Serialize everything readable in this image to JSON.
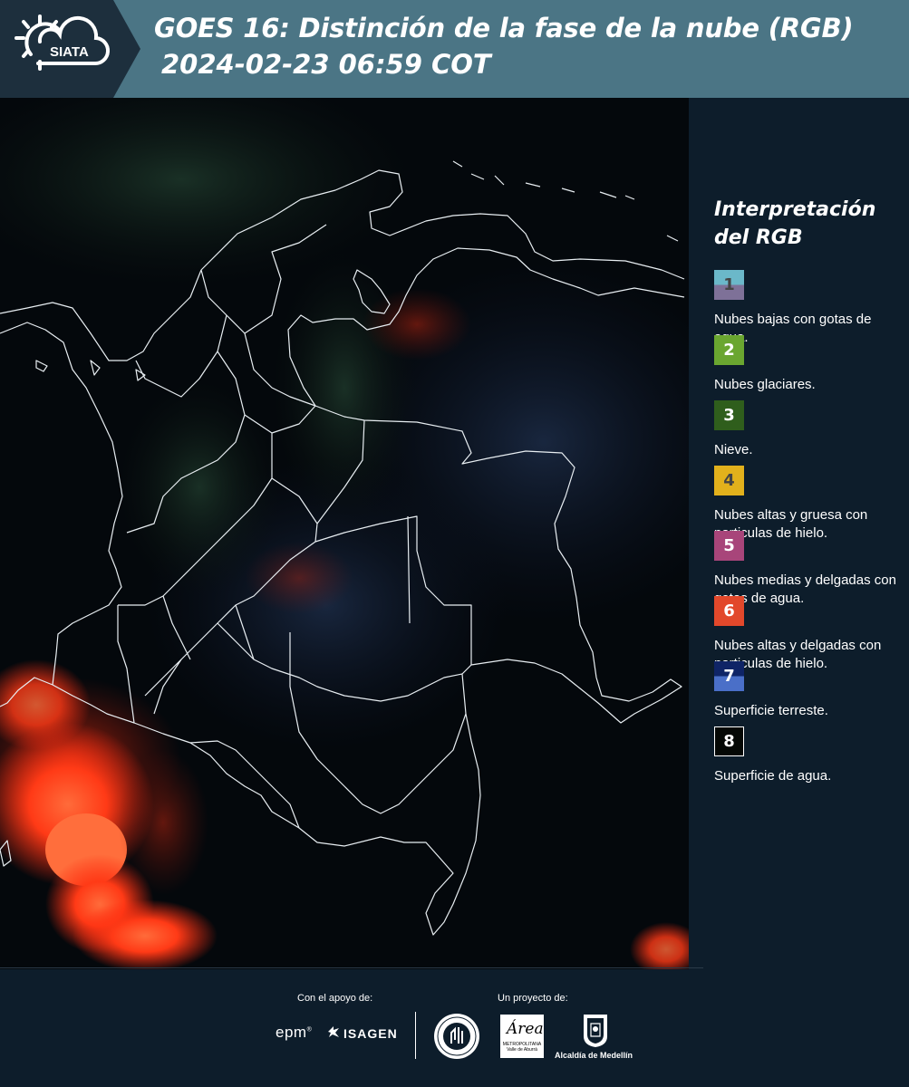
{
  "header": {
    "logo_text": "SIATA",
    "title_line1": "GOES 16: Distinción de la fase de la nube (RGB)",
    "title_line2": "2024-02-23 06:59 COT"
  },
  "legend": {
    "title_line1": "Interpretación",
    "title_line2": "del RGB",
    "items": [
      {
        "number": "1",
        "label": "Nubes bajas con gotas de agua.",
        "color_top": "#6bb8c9",
        "color_bottom": "#7e7198",
        "text_color": "#444444"
      },
      {
        "number": "2",
        "label": "Nubes glaciares.",
        "color": "#6aa630",
        "text_color": "#ffffff"
      },
      {
        "number": "3",
        "label": "Nieve.",
        "color": "#2f5e1c",
        "text_color": "#ffffff"
      },
      {
        "number": "4",
        "label": "Nubes altas y gruesa con particulas de hielo.",
        "color": "#e2b11c",
        "text_color": "#444444"
      },
      {
        "number": "5",
        "label": "Nubes medias y delgadas con gotas de agua.",
        "color": "#a8457a",
        "text_color": "#ffffff"
      },
      {
        "number": "6",
        "label": "Nubes altas y delgadas con particulas de hielo.",
        "color": "#e2482b",
        "text_color": "#ffffff"
      },
      {
        "number": "7",
        "label": "Superficie terreste.",
        "color_top": "#0f2466",
        "color_bottom": "#4a6fc8",
        "text_color": "#ffffff"
      },
      {
        "number": "8",
        "label": "Superficie de agua.",
        "color": "#050805",
        "text_color": "#ffffff",
        "border": "#ffffff"
      }
    ]
  },
  "footer": {
    "support_label": "Con el apoyo de:",
    "project_label": "Un proyecto de:",
    "epm": "epm",
    "isagen": "ISAGEN",
    "area_word": "Área",
    "area_sub": "METROPOLITANA Valle de Aburrá",
    "alcaldia": "Alcaldía de Medellín"
  }
}
